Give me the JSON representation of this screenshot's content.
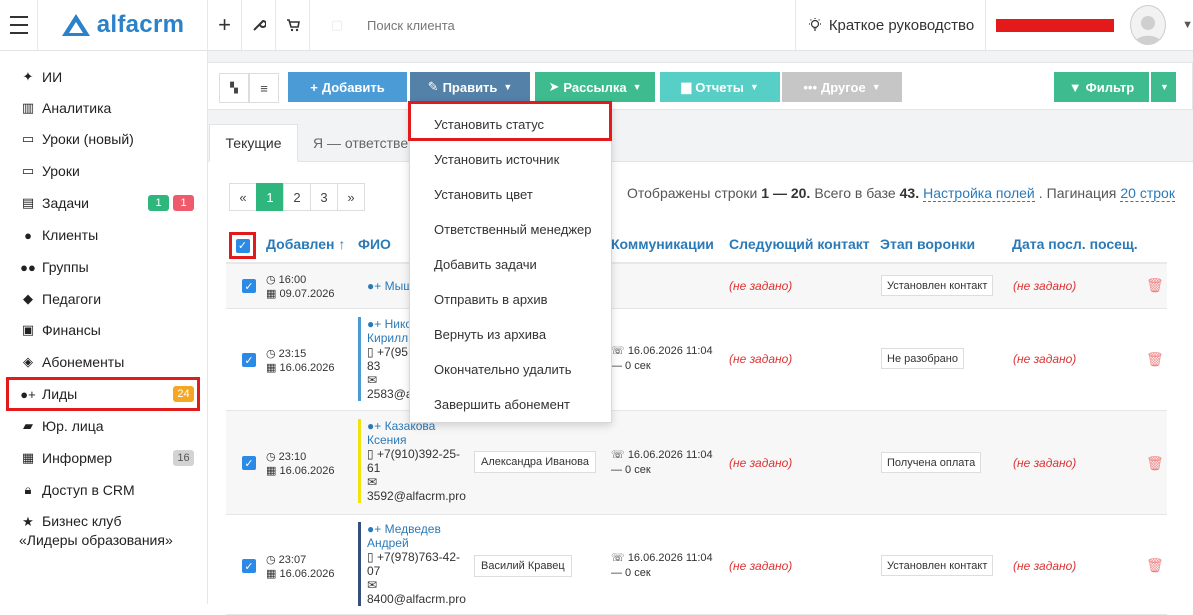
{
  "topbar": {
    "logo": "alfacrm",
    "search_placeholder": "Поиск клиента",
    "guide_label": "Краткое руководство"
  },
  "sidebar": {
    "items": [
      {
        "label": "ИИ",
        "icon": "sparkle-icon"
      },
      {
        "label": "Аналитика",
        "icon": "columns-icon"
      },
      {
        "label": "Уроки (новый)",
        "icon": "calendar-icon"
      },
      {
        "label": "Уроки",
        "icon": "calendar-icon"
      },
      {
        "label": "Задачи",
        "icon": "clipboard-icon",
        "badges": [
          "1",
          "1"
        ]
      },
      {
        "label": "Клиенты",
        "icon": "user-icon"
      },
      {
        "label": "Группы",
        "icon": "users-icon"
      },
      {
        "label": "Педагоги",
        "icon": "graduation-cap-icon"
      },
      {
        "label": "Финансы",
        "icon": "money-icon"
      },
      {
        "label": "Абонементы",
        "icon": "tag-icon"
      },
      {
        "label": "Лиды",
        "icon": "user-plus-icon",
        "badges": [
          "24"
        ]
      },
      {
        "label": "Юр. лица",
        "icon": "briefcase-icon"
      },
      {
        "label": "Информер",
        "icon": "newspaper-icon",
        "badges": [
          "16"
        ]
      },
      {
        "label": "Доступ в CRM",
        "icon": "lock-icon"
      },
      {
        "label_line1": "Бизнес клуб",
        "label_line2": "«Лидеры образования»",
        "icon": "star-icon"
      }
    ]
  },
  "toolbar": {
    "add": "Добавить",
    "edit": "Править",
    "mailing": "Рассылка",
    "reports": "Отчеты",
    "other": "Другое",
    "filter": "Фильтр"
  },
  "tabs": {
    "current": "Текущие",
    "responsible": "Я — ответствен"
  },
  "pagination": {
    "prev": "«",
    "pages": [
      "1",
      "2",
      "3"
    ],
    "next": "»"
  },
  "info": {
    "prefix": "Отображены строки",
    "range": "1 — 20.",
    "total_prefix": "Всего в базе",
    "total": "43.",
    "fields_link": "Настройка полей",
    "pagination_label": "Пагинация",
    "pagination_value": "20 строк"
  },
  "table": {
    "headers": {
      "added": "Добавлен ↑",
      "fio": "ФИО",
      "communications": "Коммуникации",
      "next_contact": "Следующий контакт",
      "funnel_stage": "Этап воронки",
      "last_visit": "Дата посл. посещ."
    },
    "rows": [
      {
        "time": "16:00",
        "date": "09.07.2026",
        "name": "Мышк",
        "manager": "",
        "comm_date": "",
        "comm_dur": "",
        "next_contact": "(не задано)",
        "stage": "Установлен контакт",
        "last_visit": "(не задано)"
      },
      {
        "time": "23:15",
        "date": "16.06.2026",
        "name_line1": "Нико",
        "name_line2": "Кирилл",
        "phone_line1": "+7(95",
        "phone_line2": "83",
        "email": "2583@al",
        "manager": "",
        "comm_date": "16.06.2026 11:04",
        "comm_dur": "— 0 сек",
        "next_contact": "(не задано)",
        "stage": "Не разобрано",
        "last_visit": "(не задано)"
      },
      {
        "time": "23:10",
        "date": "16.06.2026",
        "name_line1": "Казакова",
        "name_line2": "Ксения",
        "phone_line1": "+7(910)392-25-",
        "phone_line2": "61",
        "email": "3592@alfacrm.pro",
        "manager": "Александра Иванова",
        "comm_date": "16.06.2026 11:04",
        "comm_dur": "— 0 сек",
        "next_contact": "(не задано)",
        "stage": "Получена оплата",
        "last_visit": "(не задано)"
      },
      {
        "time": "23:07",
        "date": "16.06.2026",
        "name_line1": "Медведев",
        "name_line2": "Андрей",
        "phone_line1": "+7(978)763-42-",
        "phone_line2": "07",
        "email": "8400@alfacrm.pro",
        "manager": "Василий Кравец",
        "comm_date": "16.06.2026 11:04",
        "comm_dur": "— 0 сек",
        "next_contact": "(не задано)",
        "stage": "Установлен контакт",
        "last_visit": "(не задано)"
      }
    ]
  },
  "dropdown": {
    "items": [
      "Установить статус",
      "Установить источник",
      "Установить цвет",
      "Ответственный менеджер",
      "Добавить задачи",
      "Отправить в архив",
      "Вернуть из архива",
      "Окончательно удалить",
      "Завершить абонемент"
    ]
  },
  "colors": {
    "accent": "#2b82c9",
    "highlight": "#e11b1b",
    "green": "#2eb67d"
  }
}
